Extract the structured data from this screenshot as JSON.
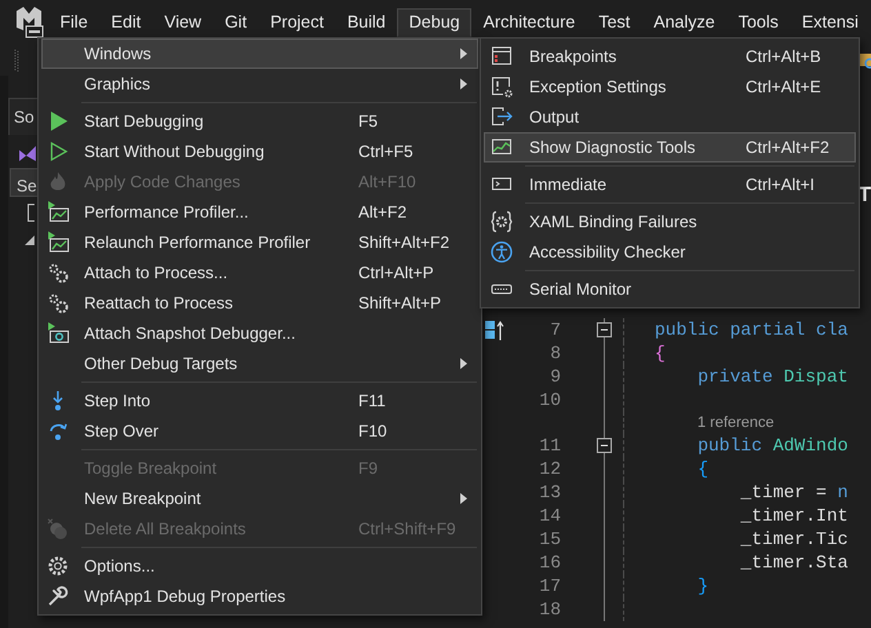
{
  "menu_bar": {
    "items": [
      {
        "label": "File",
        "selected": false
      },
      {
        "label": "Edit",
        "selected": false
      },
      {
        "label": "View",
        "selected": false
      },
      {
        "label": "Git",
        "selected": false
      },
      {
        "label": "Project",
        "selected": false
      },
      {
        "label": "Build",
        "selected": false
      },
      {
        "label": "Debug",
        "selected": true
      },
      {
        "label": "Architecture",
        "selected": false
      },
      {
        "label": "Test",
        "selected": false
      },
      {
        "label": "Analyze",
        "selected": false
      },
      {
        "label": "Tools",
        "selected": false
      },
      {
        "label": "Extensi",
        "selected": false
      }
    ]
  },
  "left_panel": {
    "tab": "So",
    "search": {
      "value": "Se"
    }
  },
  "editor": {
    "header_fragment": "T",
    "lines": [
      {
        "kind": "code",
        "number": "7",
        "foldable": true,
        "tokens": [
          {
            "text": "public partial cla",
            "kind": "keyword"
          }
        ]
      },
      {
        "kind": "code",
        "number": "8",
        "foldable": false,
        "tokens": [
          {
            "text": "{",
            "kind": "brace_outer"
          }
        ]
      },
      {
        "kind": "code",
        "number": "9",
        "foldable": false,
        "tokens": [
          {
            "text": "    private ",
            "kind": "keyword"
          },
          {
            "text": "Dispat",
            "kind": "type"
          }
        ]
      },
      {
        "kind": "code",
        "number": "10",
        "foldable": false
      },
      {
        "kind": "codelens",
        "text": "1 reference"
      },
      {
        "kind": "code",
        "number": "11",
        "foldable": true,
        "tokens": [
          {
            "text": "    public ",
            "kind": "keyword"
          },
          {
            "text": "AdWindo",
            "kind": "type"
          }
        ]
      },
      {
        "kind": "code",
        "number": "12",
        "foldable": false,
        "tokens": [
          {
            "text": "    {",
            "kind": "brace_inner"
          }
        ]
      },
      {
        "kind": "code",
        "number": "13",
        "foldable": false,
        "tokens": [
          {
            "text": "        _timer = ",
            "kind": "plain"
          },
          {
            "text": "n",
            "kind": "keyword"
          }
        ]
      },
      {
        "kind": "code",
        "number": "14",
        "foldable": false,
        "tokens": [
          {
            "text": "        _timer.Int",
            "kind": "plain"
          }
        ]
      },
      {
        "kind": "code",
        "number": "15",
        "foldable": false,
        "tokens": [
          {
            "text": "        _timer.Tic",
            "kind": "plain"
          }
        ]
      },
      {
        "kind": "code",
        "number": "16",
        "foldable": false,
        "tokens": [
          {
            "text": "        _timer.Sta",
            "kind": "plain"
          }
        ]
      },
      {
        "kind": "code",
        "number": "17",
        "foldable": false,
        "tokens": [
          {
            "text": "    }",
            "kind": "brace_inner"
          }
        ]
      },
      {
        "kind": "code",
        "number": "18",
        "foldable": false
      }
    ]
  },
  "debug_menu": {
    "items": [
      {
        "kind": "item",
        "label": "Windows",
        "has_submenu": true,
        "selected": true,
        "disabled": false
      },
      {
        "kind": "item",
        "label": "Graphics",
        "has_submenu": true,
        "selected": false,
        "disabled": false
      },
      {
        "kind": "separator"
      },
      {
        "kind": "item",
        "label": "Start Debugging",
        "shortcut": "F5",
        "has_submenu": false,
        "selected": false,
        "disabled": false
      },
      {
        "kind": "item",
        "label": "Start Without Debugging",
        "shortcut": "Ctrl+F5",
        "has_submenu": false,
        "selected": false,
        "disabled": false
      },
      {
        "kind": "item",
        "label": "Apply Code Changes",
        "shortcut": "Alt+F10",
        "has_submenu": false,
        "selected": false,
        "disabled": true
      },
      {
        "kind": "item",
        "label": "Performance Profiler...",
        "shortcut": "Alt+F2",
        "has_submenu": false,
        "selected": false,
        "disabled": false
      },
      {
        "kind": "item",
        "label": "Relaunch Performance Profiler",
        "shortcut": "Shift+Alt+F2",
        "has_submenu": false,
        "selected": false,
        "disabled": false
      },
      {
        "kind": "item",
        "label": "Attach to Process...",
        "shortcut": "Ctrl+Alt+P",
        "has_submenu": false,
        "selected": false,
        "disabled": false
      },
      {
        "kind": "item",
        "label": "Reattach to Process",
        "shortcut": "Shift+Alt+P",
        "has_submenu": false,
        "selected": false,
        "disabled": false
      },
      {
        "kind": "item",
        "label": "Attach Snapshot Debugger...",
        "has_submenu": false,
        "selected": false,
        "disabled": false
      },
      {
        "kind": "item",
        "label": "Other Debug Targets",
        "has_submenu": true,
        "selected": false,
        "disabled": false
      },
      {
        "kind": "separator"
      },
      {
        "kind": "item",
        "label": "Step Into",
        "shortcut": "F11",
        "has_submenu": false,
        "selected": false,
        "disabled": false
      },
      {
        "kind": "item",
        "label": "Step Over",
        "shortcut": "F10",
        "has_submenu": false,
        "selected": false,
        "disabled": false
      },
      {
        "kind": "separator"
      },
      {
        "kind": "item",
        "label": "Toggle Breakpoint",
        "shortcut": "F9",
        "has_submenu": false,
        "selected": false,
        "disabled": true
      },
      {
        "kind": "item",
        "label": "New Breakpoint",
        "has_submenu": true,
        "selected": false,
        "disabled": false
      },
      {
        "kind": "item",
        "label": "Delete All Breakpoints",
        "shortcut": "Ctrl+Shift+F9",
        "has_submenu": false,
        "selected": false,
        "disabled": true
      },
      {
        "kind": "separator"
      },
      {
        "kind": "item",
        "label": "Options...",
        "has_submenu": false,
        "selected": false,
        "disabled": false
      },
      {
        "kind": "item",
        "label": "WpfApp1 Debug Properties",
        "has_submenu": false,
        "selected": false,
        "disabled": false
      }
    ]
  },
  "windows_submenu": {
    "items": [
      {
        "kind": "item",
        "label": "Breakpoints",
        "shortcut": "Ctrl+Alt+B",
        "selected": false
      },
      {
        "kind": "item",
        "label": "Exception Settings",
        "shortcut": "Ctrl+Alt+E",
        "selected": false
      },
      {
        "kind": "item",
        "label": "Output",
        "selected": false
      },
      {
        "kind": "item",
        "label": "Show Diagnostic Tools",
        "shortcut": "Ctrl+Alt+F2",
        "selected": true
      },
      {
        "kind": "separator"
      },
      {
        "kind": "item",
        "label": "Immediate",
        "shortcut": "Ctrl+Alt+I",
        "selected": false
      },
      {
        "kind": "separator"
      },
      {
        "kind": "item",
        "label": "XAML Binding Failures",
        "selected": false
      },
      {
        "kind": "item",
        "label": "Accessibility Checker",
        "selected": false
      },
      {
        "kind": "separator"
      },
      {
        "kind": "item",
        "label": "Serial Monitor",
        "selected": false
      }
    ]
  }
}
